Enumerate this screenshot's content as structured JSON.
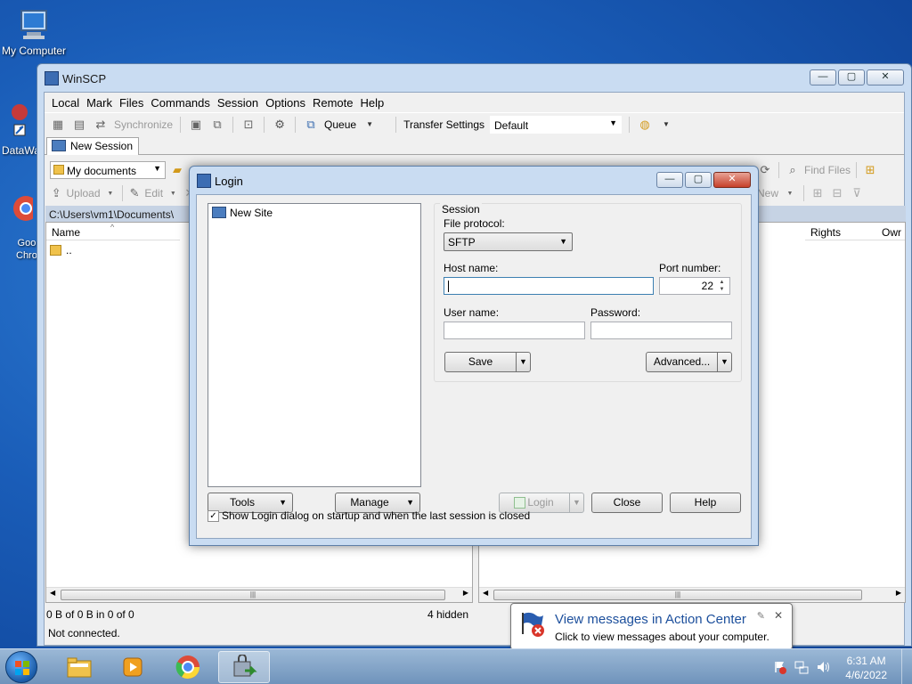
{
  "desktop": {
    "icons": [
      {
        "label": "My Computer"
      },
      {
        "label": "DataWa"
      },
      {
        "label": "Goo\nChro"
      }
    ]
  },
  "window": {
    "title": "WinSCP",
    "buttons": {
      "minimize": "—",
      "maximize": "▢",
      "close": "✕"
    }
  },
  "menu": [
    "Local",
    "Mark",
    "Files",
    "Commands",
    "Session",
    "Options",
    "Remote",
    "Help"
  ],
  "toolbar": {
    "synchronize": "Synchronize",
    "queue": "Queue",
    "transfer_settings": "Transfer Settings",
    "transfer_default": "Default",
    "find_files": "Find Files",
    "upload": "Upload",
    "edit": "Edit",
    "new": "New",
    "my_documents": "My documents"
  },
  "tab": {
    "label": "New Session"
  },
  "local": {
    "path": "C:\\Users\\vm1\\Documents\\",
    "col_name": "Name",
    "parent_row": "..",
    "status": "0 B of 0 B in 0 of 0",
    "hidden": "4 hidden"
  },
  "remote": {
    "col_rights": "Rights",
    "col_owner": "Owr"
  },
  "statusbar": {
    "text": "Not connected."
  },
  "login": {
    "title": "Login",
    "new_site": "New Site",
    "session_label": "Session",
    "file_protocol_label": "File protocol:",
    "file_protocol_value": "SFTP",
    "host_label": "Host name:",
    "host_value": "",
    "port_label": "Port number:",
    "port_value": "22",
    "user_label": "User name:",
    "user_value": "",
    "password_label": "Password:",
    "password_value": "",
    "save": "Save",
    "advanced": "Advanced...",
    "tools": "Tools",
    "manage": "Manage",
    "login_btn": "Login",
    "close_btn": "Close",
    "help_btn": "Help",
    "show_login_checkbox": "Show Login dialog on startup and when the last session is closed",
    "show_login_checked": true
  },
  "balloon": {
    "title": "View messages in Action Center",
    "text": "Click to view messages about your computer."
  },
  "taskbar": {
    "time": "6:31 AM",
    "date": "4/6/2022"
  }
}
